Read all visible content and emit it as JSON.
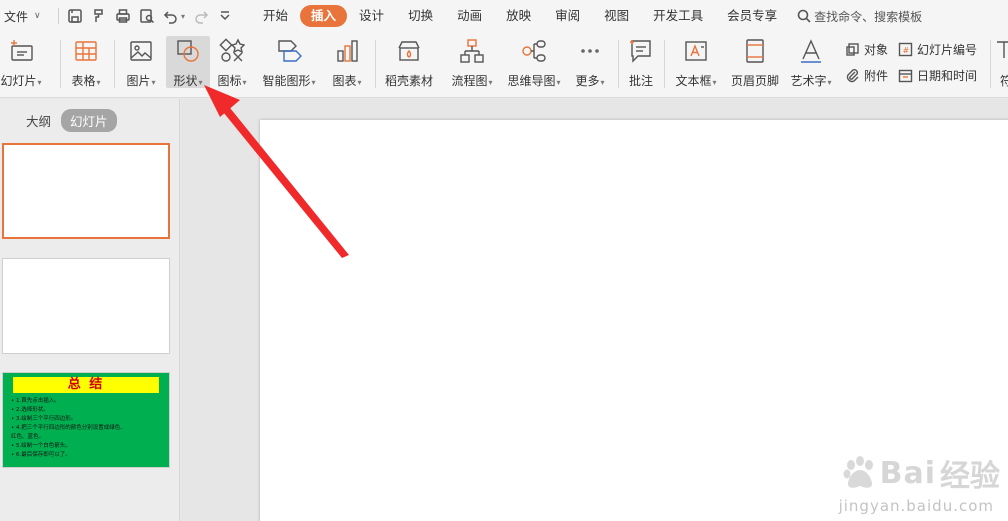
{
  "menubar": {
    "file_label": "文件",
    "tabs": [
      "开始",
      "插入",
      "设计",
      "切换",
      "动画",
      "放映",
      "审阅",
      "视图",
      "开发工具",
      "会员专享"
    ],
    "search_label": "查找命令、搜索模板"
  },
  "ribbon": {
    "slide": "幻灯片",
    "table": "表格",
    "picture": "图片",
    "shape": "形状",
    "icon": "图标",
    "smartart": "智能图形",
    "chart": "图表",
    "material": "稻壳素材",
    "flowchart": "流程图",
    "mindmap": "思维导图",
    "more": "更多",
    "comment": "批注",
    "textbox": "文本框",
    "header_footer": "页眉页脚",
    "wordart": "艺术字",
    "object": "对象",
    "attachment": "附件",
    "slide_number": "幻灯片编号",
    "datetime": "日期和时间",
    "symbol": "符"
  },
  "panel": {
    "outline_tab": "大纲",
    "slides_tab": "幻灯片",
    "thumb3_title": "总 结",
    "thumb3_lines": [
      "• 1.首先点击插入。",
      "• 2.选择形状。",
      "• 3.绘制三个平行四边形。",
      "• 4.把三个平行四边形的颜色分别设置成绿色、",
      "   红色、蓝色。",
      "• 5.绘制一个白色箭头。",
      "• 6.最后保存即可以了。"
    ]
  },
  "watermark": {
    "brand": "Bai",
    "brand2": "经验",
    "url": "jingyan.baidu.com"
  },
  "colors": {
    "accent": "#e8743b",
    "arrow": "#f02a2a",
    "thumb_green": "#00b050",
    "thumb_yellow": "#ffff00"
  }
}
